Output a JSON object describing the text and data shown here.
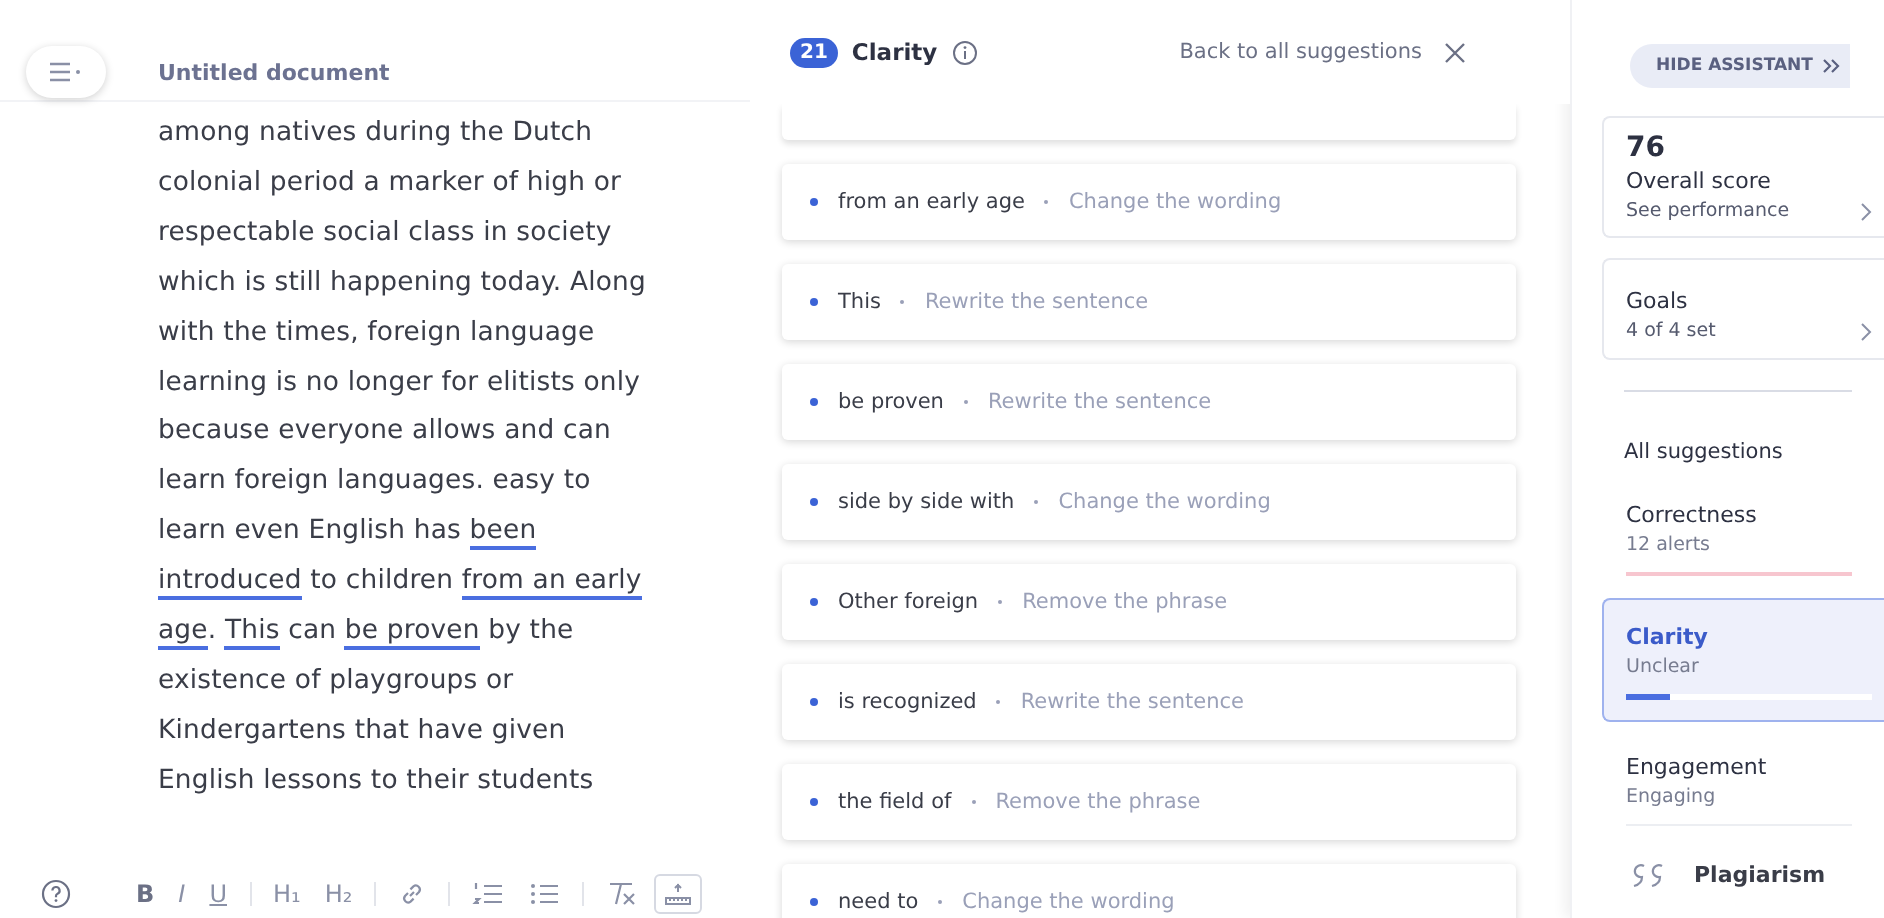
{
  "document": {
    "title": "Untitled document",
    "segments": [
      {
        "text": "among natives during the Dutch colonial period a marker of high or respectable social class in society which is still happening today. Along with the times, foreign language learning is no longer for elitists only because everyone allows and can learn foreign languages. easy to learn even English has ",
        "flagged": false
      },
      {
        "text": "been introduced",
        "flagged": true
      },
      {
        "text": " to children ",
        "flagged": false
      },
      {
        "text": "from an early age",
        "flagged": true
      },
      {
        "text": ". ",
        "flagged": false
      },
      {
        "text": "This",
        "flagged": true
      },
      {
        "text": " can ",
        "flagged": false
      },
      {
        "text": "be proven",
        "flagged": true
      },
      {
        "text": " by the existence of playgroups or Kindergartens that have given English lessons to their students",
        "flagged": false
      }
    ]
  },
  "toolbar": [
    {
      "kind": "help"
    },
    {
      "kind": "bold",
      "label": "B",
      "active": false
    },
    {
      "kind": "italic",
      "label": "I",
      "active": false
    },
    {
      "kind": "underline",
      "label": "U",
      "active": false
    },
    {
      "kind": "sep"
    },
    {
      "kind": "heading",
      "label": "H₁",
      "active": false
    },
    {
      "kind": "heading",
      "label": "H₂",
      "active": false
    },
    {
      "kind": "sep"
    },
    {
      "kind": "link",
      "active": false
    },
    {
      "kind": "sep"
    },
    {
      "kind": "ol",
      "active": false
    },
    {
      "kind": "ul",
      "active": false
    },
    {
      "kind": "sep"
    },
    {
      "kind": "clear",
      "active": false
    },
    {
      "kind": "ruler",
      "active": true
    }
  ],
  "suggestions_header": {
    "count": "21",
    "title": "Clarity",
    "back": "Back to all suggestions"
  },
  "suggestions": [
    {
      "phrase": "from an early age",
      "action": "Change the wording"
    },
    {
      "phrase": "This",
      "action": "Rewrite the sentence"
    },
    {
      "phrase": "be proven",
      "action": "Rewrite the sentence"
    },
    {
      "phrase": "side by side with",
      "action": "Change the wording"
    },
    {
      "phrase": "Other foreign",
      "action": "Remove the phrase"
    },
    {
      "phrase": "is recognized",
      "action": "Rewrite the sentence"
    },
    {
      "phrase": "the field of",
      "action": "Remove the phrase"
    },
    {
      "phrase": "need to",
      "action": "Change the wording"
    }
  ],
  "assistant": {
    "hide_button": "HIDE ASSISTANT",
    "score": {
      "value": "76",
      "label": "Overall score",
      "link": "See performance"
    },
    "goals": {
      "label": "Goals",
      "status": "4 of 4 set"
    },
    "all_suggestions": "All suggestions",
    "categories": [
      {
        "name": "Correctness",
        "status": "12 alerts",
        "selected": false,
        "level": 1,
        "color": "#f7c6cf"
      },
      {
        "name": "Clarity",
        "status": "Unclear",
        "selected": true,
        "level": 0.18,
        "color": "#4a6ee0"
      },
      {
        "name": "Engagement",
        "status": "Engaging",
        "selected": false
      }
    ],
    "plagiarism": "Plagiarism"
  }
}
